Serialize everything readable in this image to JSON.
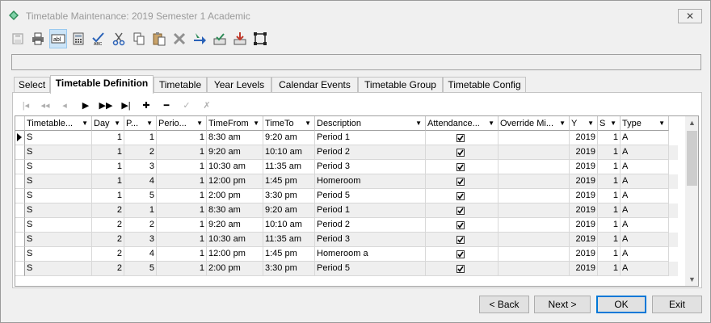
{
  "window": {
    "title": "Timetable Maintenance:  2019 Semester 1 Academic",
    "close_glyph": "✕"
  },
  "toolbar": {
    "icons": [
      "save-icon",
      "print-icon",
      "text-field-icon",
      "calculator-icon",
      "spell-check-icon",
      "cut-icon",
      "copy-icon",
      "paste-icon",
      "delete-icon",
      "arrow-icon",
      "approve-icon",
      "download-icon",
      "select-region-icon"
    ],
    "active_index": 2
  },
  "status": {
    "text": ""
  },
  "tabs": [
    {
      "label": "Select"
    },
    {
      "label": "Timetable Definition"
    },
    {
      "label": "Timetable"
    },
    {
      "label": "Year Levels"
    },
    {
      "label": "Calendar Events"
    },
    {
      "label": "Timetable Group"
    },
    {
      "label": "Timetable Config"
    }
  ],
  "active_tab": 1,
  "navigator": {
    "icons": [
      "first-disabled-icon",
      "prior-page-disabled-icon",
      "prior-disabled-icon",
      "next-icon",
      "next-page-icon",
      "last-icon",
      "add-icon",
      "delete-icon",
      "post-disabled-icon",
      "cancel-disabled-icon"
    ],
    "glyphs": [
      "|◂",
      "◂◂",
      "◂",
      "▶",
      "▶▶",
      "▶|",
      "✚",
      "━",
      "✓",
      "✗"
    ]
  },
  "grid": {
    "columns": [
      {
        "label": "Timetable...",
        "key": "timetable"
      },
      {
        "label": "Day",
        "key": "day"
      },
      {
        "label": "P...",
        "key": "period"
      },
      {
        "label": "Perio...",
        "key": "periodno"
      },
      {
        "label": "TimeFrom",
        "key": "from"
      },
      {
        "label": "TimeTo",
        "key": "to"
      },
      {
        "label": "Description",
        "key": "desc"
      },
      {
        "label": "Attendance...",
        "key": "att"
      },
      {
        "label": "Override Mi...",
        "key": "override"
      },
      {
        "label": "Y",
        "key": "year"
      },
      {
        "label": "S",
        "key": "sem"
      },
      {
        "label": "Type",
        "key": "type"
      }
    ],
    "dropdown_glyph": "▼",
    "rows": [
      {
        "timetable": "S",
        "day": "1",
        "period": "1",
        "periodno": "1",
        "from": "8:30 am",
        "to": "9:20 am",
        "desc": "Period 1",
        "att": true,
        "override": "",
        "year": "2019",
        "sem": "1",
        "type": "A"
      },
      {
        "timetable": "S",
        "day": "1",
        "period": "2",
        "periodno": "1",
        "from": "9:20 am",
        "to": "10:10 am",
        "desc": "Period 2",
        "att": true,
        "override": "",
        "year": "2019",
        "sem": "1",
        "type": "A"
      },
      {
        "timetable": "S",
        "day": "1",
        "period": "3",
        "periodno": "1",
        "from": "10:30 am",
        "to": "11:35 am",
        "desc": "Period 3",
        "att": true,
        "override": "",
        "year": "2019",
        "sem": "1",
        "type": "A"
      },
      {
        "timetable": "S",
        "day": "1",
        "period": "4",
        "periodno": "1",
        "from": "12:00 pm",
        "to": "1:45 pm",
        "desc": "Homeroom",
        "att": true,
        "override": "",
        "year": "2019",
        "sem": "1",
        "type": "A"
      },
      {
        "timetable": "S",
        "day": "1",
        "period": "5",
        "periodno": "1",
        "from": "2:00 pm",
        "to": "3:30 pm",
        "desc": "Period 5",
        "att": true,
        "override": "",
        "year": "2019",
        "sem": "1",
        "type": "A"
      },
      {
        "timetable": "S",
        "day": "2",
        "period": "1",
        "periodno": "1",
        "from": "8:30 am",
        "to": "9:20 am",
        "desc": "Period 1",
        "att": true,
        "override": "",
        "year": "2019",
        "sem": "1",
        "type": "A"
      },
      {
        "timetable": "S",
        "day": "2",
        "period": "2",
        "periodno": "1",
        "from": "9:20 am",
        "to": "10:10 am",
        "desc": "Period 2",
        "att": true,
        "override": "",
        "year": "2019",
        "sem": "1",
        "type": "A"
      },
      {
        "timetable": "S",
        "day": "2",
        "period": "3",
        "periodno": "1",
        "from": "10:30 am",
        "to": "11:35 am",
        "desc": "Period 3",
        "att": true,
        "override": "",
        "year": "2019",
        "sem": "1",
        "type": "A"
      },
      {
        "timetable": "S",
        "day": "2",
        "period": "4",
        "periodno": "1",
        "from": "12:00 pm",
        "to": "1:45 pm",
        "desc": "Homeroom a",
        "att": true,
        "override": "",
        "year": "2019",
        "sem": "1",
        "type": "A"
      },
      {
        "timetable": "S",
        "day": "2",
        "period": "5",
        "periodno": "1",
        "from": "2:00 pm",
        "to": "3:30 pm",
        "desc": "Period 5",
        "att": true,
        "override": "",
        "year": "2019",
        "sem": "1",
        "type": "A"
      }
    ],
    "current_row": 0
  },
  "scrollbar": {
    "up_glyph": "▲",
    "down_glyph": "▼"
  },
  "buttons": {
    "back": "< Back",
    "next": "Next >",
    "ok": "OK",
    "exit": "Exit"
  },
  "colors": {
    "accent": "#0078d7",
    "selection": "#cce4f7",
    "icon_blue": "#2a62b8",
    "icon_red": "#c0392b",
    "icon_green": "#2e8b57"
  }
}
